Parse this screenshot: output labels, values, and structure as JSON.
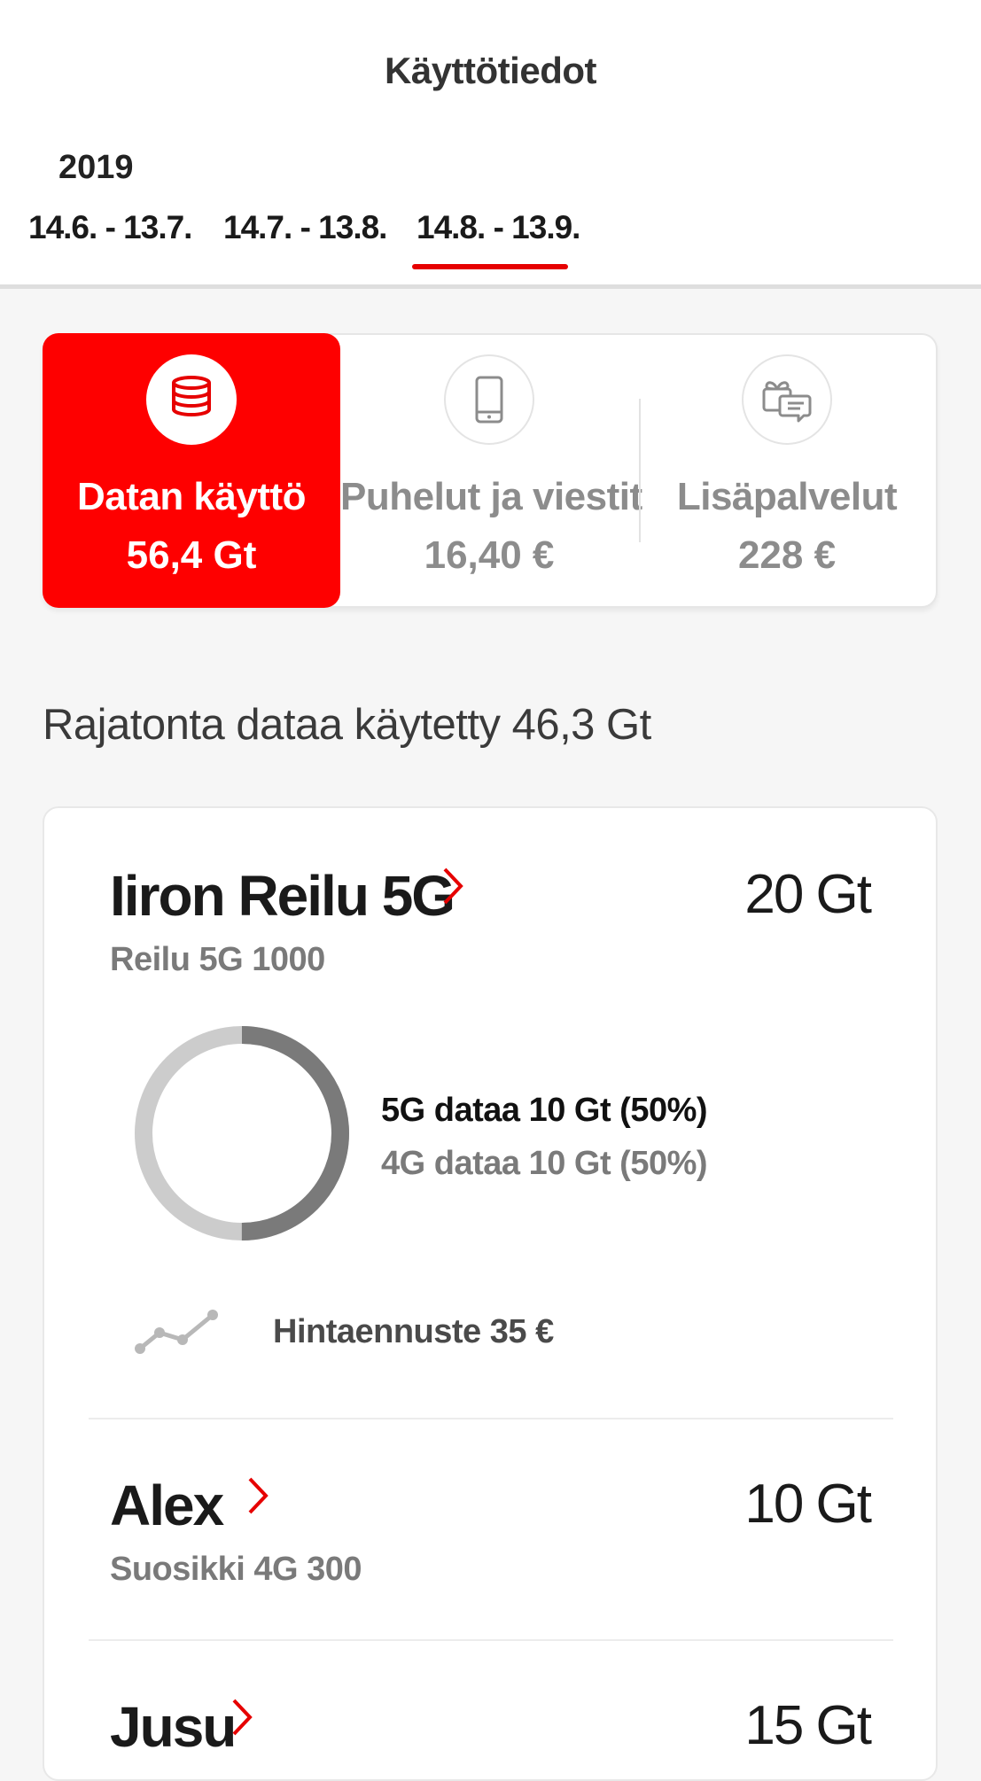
{
  "header": {
    "title": "Käyttötiedot",
    "year": "2019",
    "periods": [
      {
        "label": "14.6. - 13.7.",
        "selected": false
      },
      {
        "label": "14.7. - 13.8.",
        "selected": false
      },
      {
        "label": "14.8. - 13.9.",
        "selected": true
      }
    ]
  },
  "categories": [
    {
      "label": "Datan käyttö",
      "value": "56,4 Gt",
      "icon": "database-icon",
      "selected": true
    },
    {
      "label": "Puhelut ja viestit",
      "value": "16,40 €",
      "icon": "phone-icon",
      "selected": false
    },
    {
      "label": "Lisäpalvelut",
      "value": "228 €",
      "icon": "gift-chat-icon",
      "selected": false
    }
  ],
  "summary": "Rajatonta dataa käytetty 46,3 Gt",
  "subscriptions": [
    {
      "name": "Iiron Reilu 5G",
      "amount": "20 Gt",
      "plan": "Reilu 5G 1000",
      "breakdown": {
        "line1": "5G dataa 10 Gt (50%)",
        "line2": "4G dataa 10 Gt (50%)",
        "share_5g": 0.5,
        "share_4g": 0.5
      },
      "forecast": "Hintaennuste 35 €"
    },
    {
      "name": "Alex",
      "amount": "10 Gt",
      "plan": "Suosikki 4G 300"
    },
    {
      "name": "Jusu",
      "amount": "15 Gt",
      "plan": ""
    }
  ],
  "colors": {
    "accent": "#fe0000",
    "donut_5g": "#7a7a7a",
    "donut_4g": "#cccccc"
  }
}
